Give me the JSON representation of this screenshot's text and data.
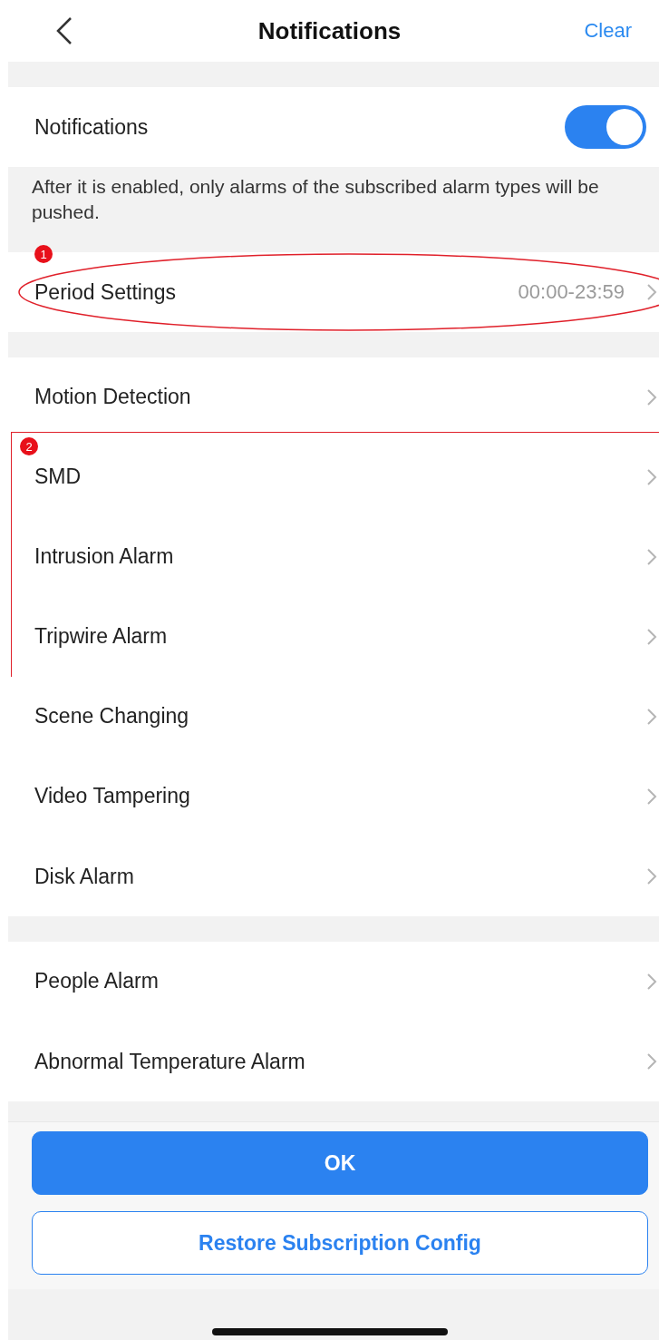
{
  "header": {
    "title": "Notifications",
    "action": "Clear"
  },
  "notifications": {
    "label": "Notifications",
    "on": true
  },
  "description": "After it is enabled, only alarms of the subscribed alarm types will be pushed.",
  "groups": [
    {
      "items": [
        {
          "kind": "ellipse",
          "number": "1",
          "items": [
            {
              "label": "Period Settings",
              "value": "00:00-23:59"
            }
          ]
        }
      ]
    },
    {
      "items": [
        {
          "kind": "row",
          "label": "Motion Detection"
        },
        {
          "kind": "rectangle",
          "number": "2",
          "items": [
            {
              "label": "SMD"
            },
            {
              "label": "Intrusion Alarm"
            },
            {
              "label": "Tripwire Alarm"
            }
          ]
        },
        {
          "kind": "row",
          "label": "Scene Changing"
        },
        {
          "kind": "row",
          "label": "Video Tampering"
        },
        {
          "kind": "row",
          "label": "Disk Alarm"
        }
      ]
    },
    {
      "items": [
        {
          "kind": "row",
          "label": "People Alarm"
        },
        {
          "kind": "row",
          "label": "Abnormal Temperature Alarm"
        }
      ]
    }
  ],
  "buttons": [
    {
      "label": "OK",
      "primary": true
    },
    {
      "label": "Restore Subscription Config",
      "primary": false
    }
  ]
}
